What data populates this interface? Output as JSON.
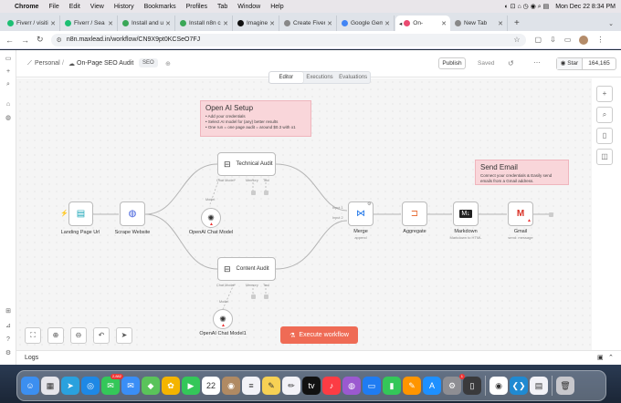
{
  "menubar": {
    "app": "Chrome",
    "items": [
      "File",
      "Edit",
      "View",
      "History",
      "Bookmarks",
      "Profiles",
      "Tab",
      "Window",
      "Help"
    ],
    "datetime": "Mon Dec 22  8:34 PM"
  },
  "tabs": [
    {
      "label": "Fiverr / visitir",
      "color": "#1dbf73"
    },
    {
      "label": "Fiverr / Sea",
      "color": "#1dbf73"
    },
    {
      "label": "Install and u",
      "color": "#3aa757"
    },
    {
      "label": "Install n8n c",
      "color": "#3aa757"
    },
    {
      "label": "Imagine",
      "color": "#111111"
    },
    {
      "label": "Create Fiverr",
      "color": "#888888"
    },
    {
      "label": "Google Gem",
      "color": "#4285f4"
    },
    {
      "label": "On-",
      "color": "#ea4b71",
      "active": true
    },
    {
      "label": "New Tab",
      "color": "#888888"
    }
  ],
  "address": {
    "url": "n8n.maxlead.in/workflow/CN9X9pt0KCSeO7FJ"
  },
  "header": {
    "breadcrumb_project": "Personal",
    "separator": "/",
    "workflow_name": "On-Page SEO Audit",
    "tag": "SEO",
    "publish_label": "Publish",
    "saved_label": "Saved",
    "star_label": "Star",
    "star_count": "164,165"
  },
  "mode_tabs": [
    {
      "label": "Editor",
      "active": true
    },
    {
      "label": "Executions",
      "active": false
    },
    {
      "label": "Evaluations",
      "active": false
    }
  ],
  "sticky_openai": {
    "title": "Open AI Setup",
    "body": "• Add your credentials\n• Select AI model for (any) better results\n• One run = one page audit = around $0.3 with o1"
  },
  "sticky_email": {
    "title": "Send Email",
    "body": "Connect your credentials & Easily send emails from a Gmail address."
  },
  "nodes": {
    "landing": {
      "label": "Landing Page Url"
    },
    "scrape": {
      "label": "Scrape Website"
    },
    "openai1": {
      "label": "OpenAI Chat Model"
    },
    "openai2": {
      "label": "OpenAI Chat Model1"
    },
    "tech_audit": {
      "label": "Technical Audit",
      "port_model": "Chat Model*",
      "port_memory": "Memory",
      "port_tool": "Tool"
    },
    "content_audit": {
      "label": "Content Audit",
      "port_model": "Chat Model*",
      "port_memory": "Memory",
      "port_tool": "Tool"
    },
    "merge": {
      "label": "Merge",
      "sub": "append",
      "input1": "Input 1",
      "input2": "Input 2"
    },
    "aggregate": {
      "label": "Aggregate"
    },
    "markdown": {
      "label": "Markdown",
      "sub": "Markdown to HTML"
    },
    "gmail": {
      "label": "Gmail",
      "sub": "send: message"
    },
    "model_label_1": "Model",
    "model_label_2": "Model"
  },
  "execute_label": "Execute workflow",
  "logs_label": "Logs",
  "dock": [
    {
      "name": "finder",
      "color": "#3c8ff0",
      "glyph": "☺"
    },
    {
      "name": "launchpad",
      "color": "#e5e5ea",
      "glyph": "▦"
    },
    {
      "name": "telegram",
      "color": "#2aa1de",
      "glyph": "➤"
    },
    {
      "name": "safari",
      "color": "#1e88e5",
      "glyph": "◎"
    },
    {
      "name": "messages",
      "color": "#34c759",
      "glyph": "✉",
      "badge": "2,882"
    },
    {
      "name": "mail",
      "color": "#3a8ef6",
      "glyph": "✉"
    },
    {
      "name": "maps",
      "color": "#5ac35a",
      "glyph": "◆"
    },
    {
      "name": "photos",
      "color": "#f4b400",
      "glyph": "✿"
    },
    {
      "name": "facetime",
      "color": "#34c759",
      "glyph": "▶"
    },
    {
      "name": "calendar",
      "color": "#ffffff",
      "glyph": "22"
    },
    {
      "name": "contacts",
      "color": "#b08a63",
      "glyph": "◉"
    },
    {
      "name": "reminders",
      "color": "#f2f2f7",
      "glyph": "≡"
    },
    {
      "name": "notes",
      "color": "#f7d154",
      "glyph": "✎"
    },
    {
      "name": "freeform",
      "color": "#f2f2f7",
      "glyph": "✏"
    },
    {
      "name": "apple-tv",
      "color": "#111111",
      "glyph": "tv"
    },
    {
      "name": "music",
      "color": "#fc3c44",
      "glyph": "♪"
    },
    {
      "name": "podcasts",
      "color": "#9b59d0",
      "glyph": "◍"
    },
    {
      "name": "keynote",
      "color": "#1f7cf2",
      "glyph": "▭"
    },
    {
      "name": "numbers",
      "color": "#34c759",
      "glyph": "▮"
    },
    {
      "name": "pages",
      "color": "#ff9500",
      "glyph": "✎"
    },
    {
      "name": "app-store",
      "color": "#1e90ff",
      "glyph": "A"
    },
    {
      "name": "system-settings",
      "color": "#8e8e93",
      "glyph": "⚙",
      "badge": "1"
    },
    {
      "name": "iphone-mirroring",
      "color": "#3a3a3c",
      "glyph": "▯"
    },
    {
      "name": "chrome",
      "color": "#ffffff",
      "glyph": "◉"
    },
    {
      "name": "vscode",
      "color": "#1f8ad2",
      "glyph": "❮❯"
    },
    {
      "name": "preview",
      "color": "#f2f2f7",
      "glyph": "▤"
    },
    {
      "name": "trash",
      "color": "#c7c7cc",
      "glyph": "🗑"
    }
  ]
}
